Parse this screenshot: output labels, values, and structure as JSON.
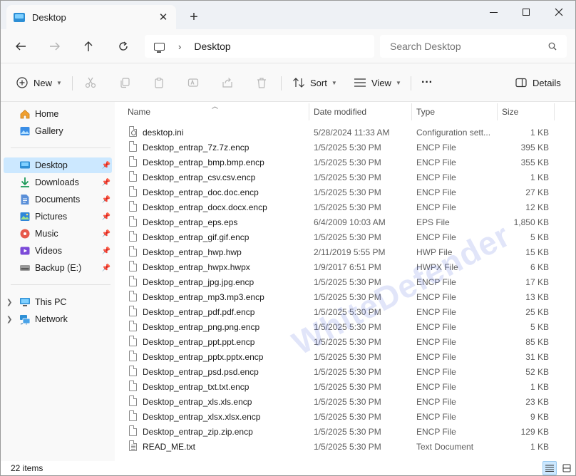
{
  "window": {
    "tab_title": "Desktop",
    "tab_close": "✕",
    "new_tab": "+"
  },
  "address": {
    "location_icon": "this-pc-icon",
    "breadcrumb": "Desktop",
    "separator": "›",
    "search_placeholder": "Search Desktop"
  },
  "commands": {
    "new_label": "New",
    "sort_label": "Sort",
    "view_label": "View",
    "more_label": "···",
    "details_label": "Details"
  },
  "sidebar": {
    "items": [
      {
        "label": "Home",
        "icon": "home-icon",
        "pinned": false
      },
      {
        "label": "Gallery",
        "icon": "gallery-icon",
        "pinned": false
      },
      {
        "label": "Desktop",
        "icon": "desktop-icon",
        "pinned": true,
        "selected": true
      },
      {
        "label": "Downloads",
        "icon": "downloads-icon",
        "pinned": true
      },
      {
        "label": "Documents",
        "icon": "documents-icon",
        "pinned": true
      },
      {
        "label": "Pictures",
        "icon": "pictures-icon",
        "pinned": true
      },
      {
        "label": "Music",
        "icon": "music-icon",
        "pinned": true
      },
      {
        "label": "Videos",
        "icon": "videos-icon",
        "pinned": true
      },
      {
        "label": "Backup (E:)",
        "icon": "drive-icon",
        "pinned": true
      },
      {
        "label": "This PC",
        "icon": "this-pc-icon",
        "pinned": false
      },
      {
        "label": "Network",
        "icon": "network-icon",
        "pinned": false
      }
    ]
  },
  "columns": {
    "name": "Name",
    "date": "Date modified",
    "type": "Type",
    "size": "Size"
  },
  "files": [
    {
      "name": "desktop.ini",
      "date": "5/28/2024 11:33 AM",
      "type": "Configuration sett...",
      "size": "1 KB",
      "icon": "settings-file-icon"
    },
    {
      "name": "Desktop_entrap_7z.7z.encp",
      "date": "1/5/2025 5:30 PM",
      "type": "ENCP File",
      "size": "395 KB",
      "icon": "file-icon"
    },
    {
      "name": "Desktop_entrap_bmp.bmp.encp",
      "date": "1/5/2025 5:30 PM",
      "type": "ENCP File",
      "size": "355 KB",
      "icon": "file-icon"
    },
    {
      "name": "Desktop_entrap_csv.csv.encp",
      "date": "1/5/2025 5:30 PM",
      "type": "ENCP File",
      "size": "1 KB",
      "icon": "file-icon"
    },
    {
      "name": "Desktop_entrap_doc.doc.encp",
      "date": "1/5/2025 5:30 PM",
      "type": "ENCP File",
      "size": "27 KB",
      "icon": "file-icon"
    },
    {
      "name": "Desktop_entrap_docx.docx.encp",
      "date": "1/5/2025 5:30 PM",
      "type": "ENCP File",
      "size": "12 KB",
      "icon": "file-icon"
    },
    {
      "name": "Desktop_entrap_eps.eps",
      "date": "6/4/2009 10:03 AM",
      "type": "EPS File",
      "size": "1,850 KB",
      "icon": "file-icon"
    },
    {
      "name": "Desktop_entrap_gif.gif.encp",
      "date": "1/5/2025 5:30 PM",
      "type": "ENCP File",
      "size": "5 KB",
      "icon": "file-icon"
    },
    {
      "name": "Desktop_entrap_hwp.hwp",
      "date": "2/11/2019 5:55 PM",
      "type": "HWP File",
      "size": "15 KB",
      "icon": "file-icon"
    },
    {
      "name": "Desktop_entrap_hwpx.hwpx",
      "date": "1/9/2017 6:51 PM",
      "type": "HWPX File",
      "size": "6 KB",
      "icon": "file-icon"
    },
    {
      "name": "Desktop_entrap_jpg.jpg.encp",
      "date": "1/5/2025 5:30 PM",
      "type": "ENCP File",
      "size": "17 KB",
      "icon": "file-icon"
    },
    {
      "name": "Desktop_entrap_mp3.mp3.encp",
      "date": "1/5/2025 5:30 PM",
      "type": "ENCP File",
      "size": "13 KB",
      "icon": "file-icon"
    },
    {
      "name": "Desktop_entrap_pdf.pdf.encp",
      "date": "1/5/2025 5:30 PM",
      "type": "ENCP File",
      "size": "25 KB",
      "icon": "file-icon"
    },
    {
      "name": "Desktop_entrap_png.png.encp",
      "date": "1/5/2025 5:30 PM",
      "type": "ENCP File",
      "size": "5 KB",
      "icon": "file-icon"
    },
    {
      "name": "Desktop_entrap_ppt.ppt.encp",
      "date": "1/5/2025 5:30 PM",
      "type": "ENCP File",
      "size": "85 KB",
      "icon": "file-icon"
    },
    {
      "name": "Desktop_entrap_pptx.pptx.encp",
      "date": "1/5/2025 5:30 PM",
      "type": "ENCP File",
      "size": "31 KB",
      "icon": "file-icon"
    },
    {
      "name": "Desktop_entrap_psd.psd.encp",
      "date": "1/5/2025 5:30 PM",
      "type": "ENCP File",
      "size": "52 KB",
      "icon": "file-icon"
    },
    {
      "name": "Desktop_entrap_txt.txt.encp",
      "date": "1/5/2025 5:30 PM",
      "type": "ENCP File",
      "size": "1 KB",
      "icon": "file-icon"
    },
    {
      "name": "Desktop_entrap_xls.xls.encp",
      "date": "1/5/2025 5:30 PM",
      "type": "ENCP File",
      "size": "23 KB",
      "icon": "file-icon"
    },
    {
      "name": "Desktop_entrap_xlsx.xlsx.encp",
      "date": "1/5/2025 5:30 PM",
      "type": "ENCP File",
      "size": "9 KB",
      "icon": "file-icon"
    },
    {
      "name": "Desktop_entrap_zip.zip.encp",
      "date": "1/5/2025 5:30 PM",
      "type": "ENCP File",
      "size": "129 KB",
      "icon": "file-icon"
    },
    {
      "name": "READ_ME.txt",
      "date": "1/5/2025 5:30 PM",
      "type": "Text Document",
      "size": "1 KB",
      "icon": "text-file-icon"
    }
  ],
  "status": {
    "item_count": "22 items"
  },
  "watermark": {
    "text": "WhiteDefender"
  },
  "colors": {
    "selection": "#cce8ff",
    "accent": "#0067c0",
    "titlebar": "#eef1f5"
  }
}
